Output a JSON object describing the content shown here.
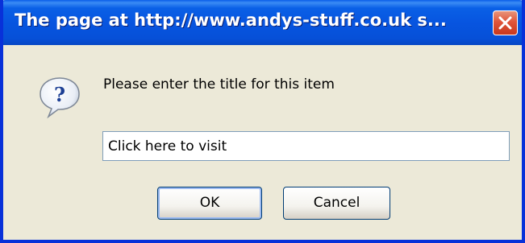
{
  "dialog": {
    "title": "The page at http://www.andys-stuff.co.uk s...",
    "close_icon": "close-icon",
    "message_icon": "question-icon",
    "message": "Please enter the title for this item",
    "input": {
      "value": "Click here to visit",
      "placeholder": ""
    },
    "buttons": {
      "ok_label": "OK",
      "cancel_label": "Cancel"
    },
    "colors": {
      "titlebar": "#0755e0",
      "close_button": "#e0553a",
      "body": "#ece9d8",
      "frame": "#0831d9"
    }
  }
}
